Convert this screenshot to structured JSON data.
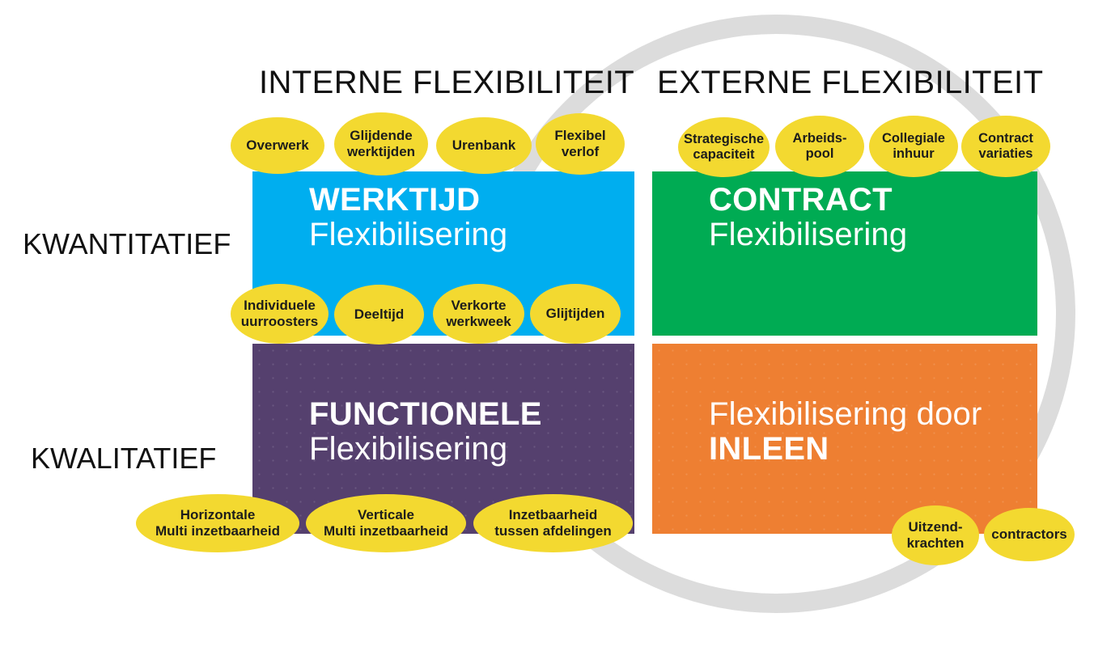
{
  "headers": {
    "internal": "INTERNE FLEXIBILITEIT",
    "external": "EXTERNE FLEXIBILITEIT"
  },
  "row_labels": {
    "quantitative": "KWANTITATIEF",
    "qualitative": "KWALITATIEF"
  },
  "quadrants": {
    "werktijd": {
      "strong": "WERKTIJD",
      "light": "Flexibilisering",
      "color": "#00AEEF"
    },
    "contract": {
      "strong": "CONTRACT",
      "light": "Flexibilisering",
      "color": "#00AB53"
    },
    "functionele": {
      "strong": "FUNCTIONELE",
      "light": "Flexibilisering",
      "color": "#55406E"
    },
    "inleen": {
      "light": "Flexibilisering door",
      "strong": "INLEEN",
      "color": "#EE7F32"
    }
  },
  "bubbles": {
    "werktijd_top": [
      {
        "line1": "Overwerk",
        "line2": ""
      },
      {
        "line1": "Glijdende",
        "line2": "werktijden"
      },
      {
        "line1": "Urenbank",
        "line2": ""
      },
      {
        "line1": "Flexibel",
        "line2": "verlof"
      }
    ],
    "werktijd_bottom": [
      {
        "line1": "Individuele",
        "line2": "uurroosters"
      },
      {
        "line1": "Deeltijd",
        "line2": ""
      },
      {
        "line1": "Verkorte",
        "line2": "werkweek"
      },
      {
        "line1": "Glijtijden",
        "line2": ""
      }
    ],
    "contract_top": [
      {
        "line1": "Strategische",
        "line2": "capaciteit"
      },
      {
        "line1": "Arbeids-",
        "line2": "pool"
      },
      {
        "line1": "Collegiale",
        "line2": "inhuur"
      },
      {
        "line1": "Contract",
        "line2": "variaties"
      }
    ],
    "functionele_bottom": [
      {
        "line1": "Horizontale",
        "line2": "Multi inzetbaarheid"
      },
      {
        "line1": "Verticale",
        "line2": "Multi inzetbaarheid"
      },
      {
        "line1": "Inzetbaarheid",
        "line2": "tussen afdelingen"
      }
    ],
    "inleen_bottom": [
      {
        "line1": "Uitzend-",
        "line2": "krachten"
      },
      {
        "line1": "contractors",
        "line2": ""
      }
    ]
  },
  "colors": {
    "bubble": "#F3D930",
    "ring": "#DCDCDC",
    "text_dark": "#1D1D1B"
  }
}
